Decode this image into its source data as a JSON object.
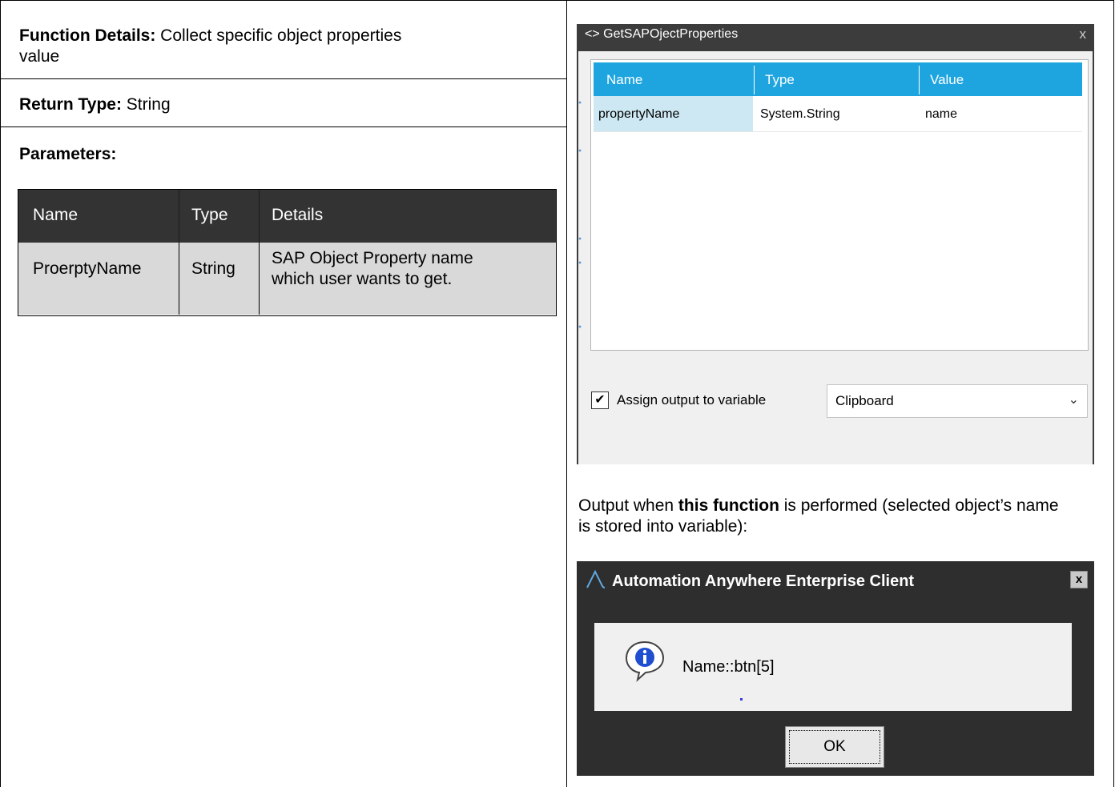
{
  "function_details": {
    "label": "Function Details:",
    "text": " Collect specific object properties",
    "text2": "value"
  },
  "return_type": {
    "label": "Return Type:",
    "text": " String"
  },
  "parameters": {
    "label": "Parameters:"
  },
  "params_table": {
    "headers": [
      "Name",
      "Type",
      "Details"
    ],
    "rows": [
      {
        "name": "ProerptyName",
        "type": "String",
        "details_line1": "SAP Object Property name",
        "details_line2": "which user wants to get."
      }
    ]
  },
  "sap_dialog": {
    "title": "<> GetSAPOjectProperties",
    "close": "x",
    "grid_headers": [
      "Name",
      "Type",
      "Value"
    ],
    "grid_row": [
      "propertyName",
      "System.String",
      "name"
    ],
    "checkbox_checked": "✔",
    "assign_label": "Assign output to variable",
    "variable_value": "Clipboard"
  },
  "output_text": {
    "part1": "Output when ",
    "bold": "this function",
    "part2": " is performed (selected object’s name is stored into variable):"
  },
  "message_box": {
    "title": "Automation Anywhere Enterprise Client",
    "close": "x",
    "message": "Name::btn[5]",
    "ok_label": "OK"
  },
  "colors": {
    "accent_header": "#1ea5e0",
    "table_header": "#333333",
    "table_row": "#d9d9d9"
  }
}
